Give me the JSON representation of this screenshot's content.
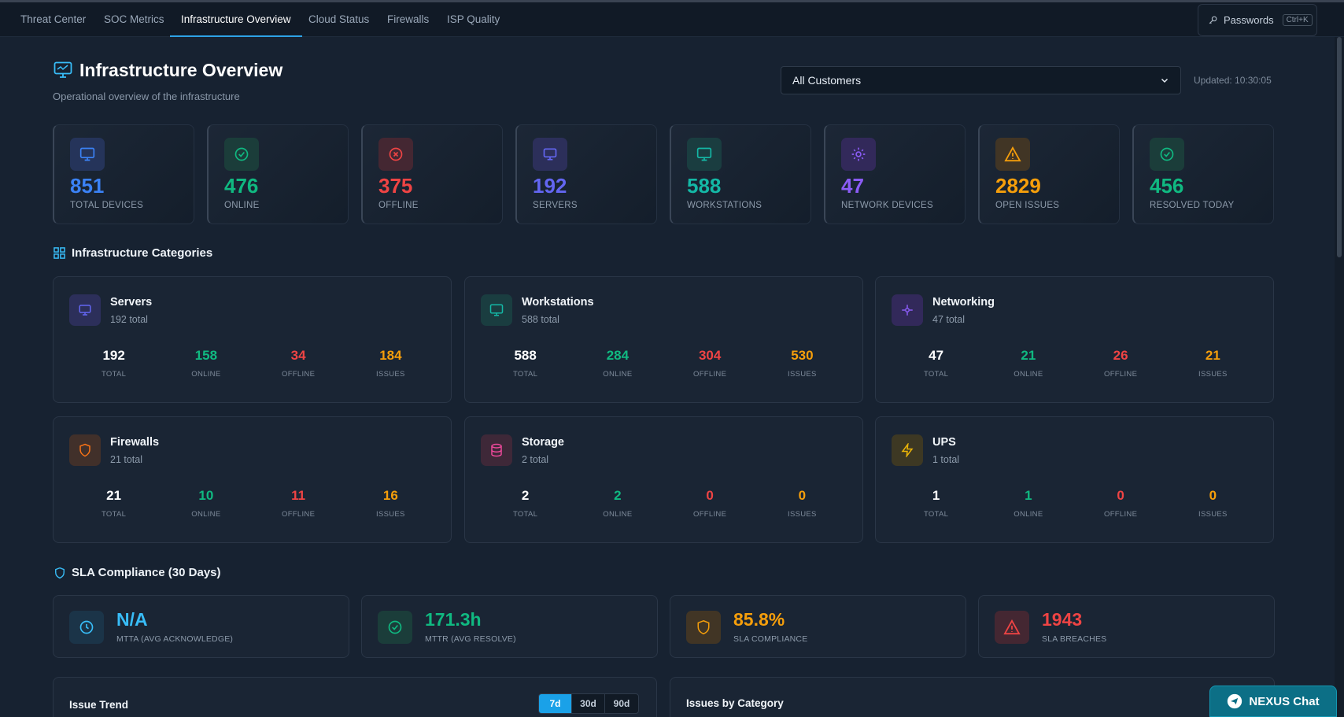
{
  "nav": {
    "tabs": [
      "Threat Center",
      "SOC Metrics",
      "Infrastructure Overview",
      "Cloud Status",
      "Firewalls",
      "ISP Quality"
    ],
    "passwords_label": "Passwords",
    "passwords_shortcut": "Ctrl+K"
  },
  "header": {
    "title": "Infrastructure Overview",
    "subtitle": "Operational overview of the infrastructure",
    "customer_select": "All Customers",
    "updated": "Updated: 10:30:05"
  },
  "stats": [
    {
      "value": "851",
      "label": "TOTAL DEVICES",
      "icon": "monitor-icon",
      "color": "#3b82f6"
    },
    {
      "value": "476",
      "label": "ONLINE",
      "icon": "check-circle-icon",
      "color": "#10b981"
    },
    {
      "value": "375",
      "label": "OFFLINE",
      "icon": "x-circle-icon",
      "color": "#ef4444"
    },
    {
      "value": "192",
      "label": "SERVERS",
      "icon": "server-icon",
      "color": "#6366f1"
    },
    {
      "value": "588",
      "label": "WORKSTATIONS",
      "icon": "workstation-icon",
      "color": "#14b8a6"
    },
    {
      "value": "47",
      "label": "NETWORK DEVICES",
      "icon": "network-icon",
      "color": "#8b5cf6"
    },
    {
      "value": "2829",
      "label": "OPEN ISSUES",
      "icon": "warning-icon",
      "color": "#f59e0b"
    },
    {
      "value": "456",
      "label": "RESOLVED TODAY",
      "icon": "check-circle-icon",
      "color": "#10b981"
    }
  ],
  "categories": {
    "title": "Infrastructure Categories",
    "stat_labels": [
      "TOTAL",
      "ONLINE",
      "OFFLINE",
      "ISSUES"
    ],
    "items": [
      {
        "name": "Servers",
        "total_text": "192 total",
        "values": [
          "192",
          "158",
          "34",
          "184"
        ],
        "icon": "server-icon",
        "color": "#6366f1"
      },
      {
        "name": "Workstations",
        "total_text": "588 total",
        "values": [
          "588",
          "284",
          "304",
          "530"
        ],
        "icon": "workstation-icon",
        "color": "#14b8a6"
      },
      {
        "name": "Networking",
        "total_text": "47 total",
        "values": [
          "47",
          "21",
          "26",
          "21"
        ],
        "icon": "network-icon",
        "color": "#8b5cf6"
      },
      {
        "name": "Firewalls",
        "total_text": "21 total",
        "values": [
          "21",
          "10",
          "11",
          "16"
        ],
        "icon": "shield-icon",
        "color": "#f97316"
      },
      {
        "name": "Storage",
        "total_text": "2 total",
        "values": [
          "2",
          "2",
          "0",
          "0"
        ],
        "icon": "database-icon",
        "color": "#ec4899"
      },
      {
        "name": "UPS",
        "total_text": "1 total",
        "values": [
          "1",
          "1",
          "0",
          "0"
        ],
        "icon": "lightning-icon",
        "color": "#eab308"
      }
    ]
  },
  "sla": {
    "title": "SLA Compliance (30 Days)",
    "items": [
      {
        "value": "N/A",
        "label": "MTTA (AVG ACKNOWLEDGE)",
        "icon": "clock-icon",
        "color": "#38bdf8"
      },
      {
        "value": "171.3h",
        "label": "MTTR (AVG RESOLVE)",
        "icon": "check-circle-icon",
        "color": "#10b981"
      },
      {
        "value": "85.8%",
        "label": "SLA COMPLIANCE",
        "icon": "shield-icon",
        "color": "#f59e0b"
      },
      {
        "value": "1943",
        "label": "SLA BREACHES",
        "icon": "warning-icon",
        "color": "#ef4444"
      }
    ]
  },
  "panels": {
    "trend_title": "Issue Trend",
    "ranges": [
      "7d",
      "30d",
      "90d"
    ],
    "category_title": "Issues by Category"
  },
  "chat": {
    "label": "NEXUS Chat"
  },
  "colors": {
    "accent": "#1aa1e8",
    "online": "#10b981",
    "offline": "#ef4444",
    "issues": "#f59e0b"
  }
}
